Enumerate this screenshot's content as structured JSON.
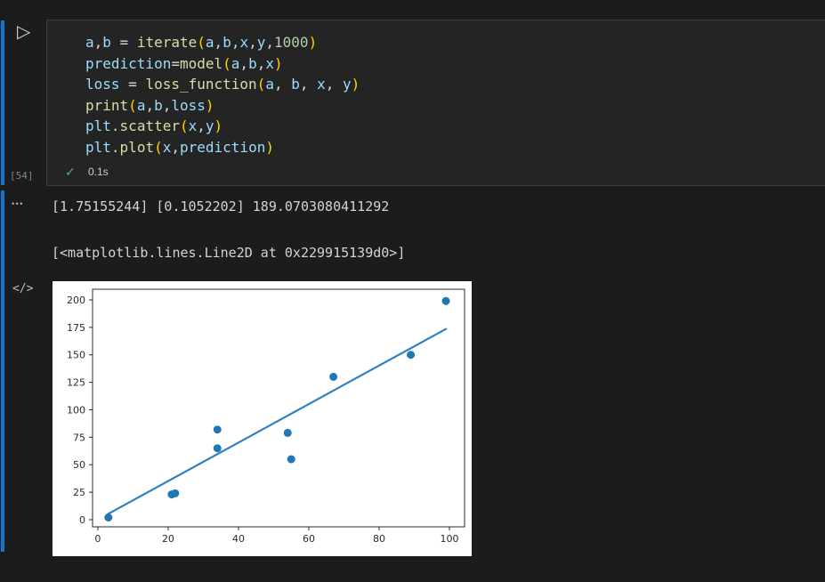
{
  "colors": {
    "window_bg": "#1c1c1c",
    "cell_bg": "#242424",
    "cell_border": "#3d3d3d",
    "focus_bar": "#0d77d1",
    "success_green": "#4fb860",
    "scatter_dot": "#1f77b4",
    "regression_line": "#2e81c4"
  },
  "gutter": {
    "run_glyph": "▷",
    "execution_count": "[54]",
    "more_glyph": "•••",
    "mime_glyph": "</>"
  },
  "cell": {
    "status": {
      "check_glyph": "✓",
      "duration": "0.1s"
    },
    "code_lines": [
      [
        {
          "t": "a",
          "c": "v"
        },
        {
          "t": ",",
          "c": "o"
        },
        {
          "t": "b",
          "c": "v"
        },
        {
          "t": " = ",
          "c": "o"
        },
        {
          "t": "iterate",
          "c": "f"
        },
        {
          "t": "(",
          "c": "p"
        },
        {
          "t": "a",
          "c": "v"
        },
        {
          "t": ",",
          "c": "o"
        },
        {
          "t": "b",
          "c": "v"
        },
        {
          "t": ",",
          "c": "o"
        },
        {
          "t": "x",
          "c": "v"
        },
        {
          "t": ",",
          "c": "o"
        },
        {
          "t": "y",
          "c": "v"
        },
        {
          "t": ",",
          "c": "o"
        },
        {
          "t": "1000",
          "c": "n"
        },
        {
          "t": ")",
          "c": "p"
        }
      ],
      [
        {
          "t": "prediction",
          "c": "v"
        },
        {
          "t": "=",
          "c": "o"
        },
        {
          "t": "model",
          "c": "f"
        },
        {
          "t": "(",
          "c": "p"
        },
        {
          "t": "a",
          "c": "v"
        },
        {
          "t": ",",
          "c": "o"
        },
        {
          "t": "b",
          "c": "v"
        },
        {
          "t": ",",
          "c": "o"
        },
        {
          "t": "x",
          "c": "v"
        },
        {
          "t": ")",
          "c": "p"
        }
      ],
      [
        {
          "t": "loss",
          "c": "v"
        },
        {
          "t": " = ",
          "c": "o"
        },
        {
          "t": "loss_function",
          "c": "f"
        },
        {
          "t": "(",
          "c": "p"
        },
        {
          "t": "a",
          "c": "v"
        },
        {
          "t": ", ",
          "c": "o"
        },
        {
          "t": "b",
          "c": "v"
        },
        {
          "t": ", ",
          "c": "o"
        },
        {
          "t": "x",
          "c": "v"
        },
        {
          "t": ", ",
          "c": "o"
        },
        {
          "t": "y",
          "c": "v"
        },
        {
          "t": ")",
          "c": "p"
        }
      ],
      [
        {
          "t": "print",
          "c": "f"
        },
        {
          "t": "(",
          "c": "p"
        },
        {
          "t": "a",
          "c": "v"
        },
        {
          "t": ",",
          "c": "o"
        },
        {
          "t": "b",
          "c": "v"
        },
        {
          "t": ",",
          "c": "o"
        },
        {
          "t": "loss",
          "c": "v"
        },
        {
          "t": ")",
          "c": "p"
        }
      ],
      [
        {
          "t": "plt",
          "c": "v"
        },
        {
          "t": ".",
          "c": "o"
        },
        {
          "t": "scatter",
          "c": "f"
        },
        {
          "t": "(",
          "c": "p"
        },
        {
          "t": "x",
          "c": "v"
        },
        {
          "t": ",",
          "c": "o"
        },
        {
          "t": "y",
          "c": "v"
        },
        {
          "t": ")",
          "c": "p"
        }
      ],
      [
        {
          "t": "plt",
          "c": "v"
        },
        {
          "t": ".",
          "c": "o"
        },
        {
          "t": "plot",
          "c": "f"
        },
        {
          "t": "(",
          "c": "p"
        },
        {
          "t": "x",
          "c": "v"
        },
        {
          "t": ",",
          "c": "o"
        },
        {
          "t": "prediction",
          "c": "v"
        },
        {
          "t": ")",
          "c": "p"
        }
      ]
    ]
  },
  "outputs": {
    "text1": "[1.75155244] [0.1052202] 189.0703080411292",
    "text2": "[<matplotlib.lines.Line2D at 0x229915139d0>]"
  },
  "chart_data": {
    "type": "scatter",
    "title": "",
    "xlabel": "",
    "ylabel": "",
    "grid": false,
    "legend": null,
    "scatter": {
      "x": [
        3,
        21,
        22,
        34,
        34,
        54,
        55,
        67,
        89,
        99
      ],
      "y": [
        2,
        23,
        24,
        65,
        82,
        79,
        55,
        130,
        150,
        199
      ]
    },
    "line": {
      "slope": 1.75155244,
      "intercept": 0.1052202,
      "x_start": 3,
      "x_end": 99
    },
    "xlim": [
      -1.5,
      104.3
    ],
    "ylim": [
      -6.5,
      209.7
    ],
    "xticks": [
      0,
      20,
      40,
      60,
      80,
      100
    ],
    "yticks": [
      0,
      25,
      50,
      75,
      100,
      125,
      150,
      175,
      200
    ],
    "dot_color": "#1f77b4",
    "line_color": "#2e81c4",
    "axes_rect": [
      45,
      9,
      418,
      267
    ],
    "fig_size": [
      471,
      309
    ]
  }
}
